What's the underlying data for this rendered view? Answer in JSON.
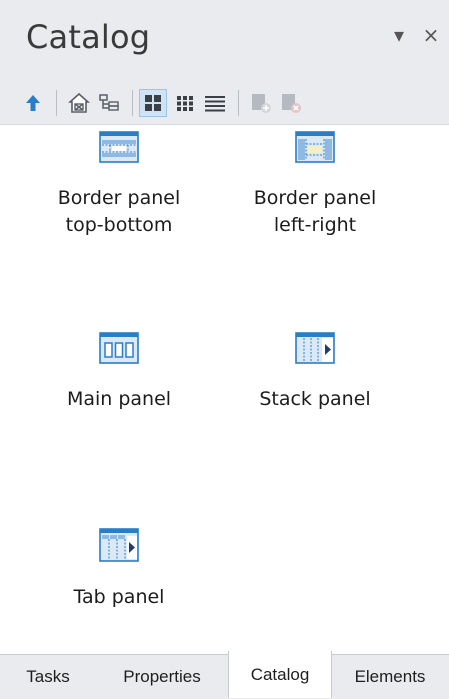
{
  "panel": {
    "title": "Catalog",
    "dropdown_icon": "triangle-down-icon",
    "close_icon": "close-icon",
    "dropdown_glyph": "▾",
    "close_glyph": "×"
  },
  "toolbar": {
    "buttons": [
      {
        "icon": "up-arrow-icon",
        "active": false
      },
      {
        "icon": "home-icon",
        "active": false
      },
      {
        "icon": "tree-view-icon",
        "active": false
      },
      {
        "icon": "large-icons-view-icon",
        "active": true
      },
      {
        "icon": "small-icons-view-icon",
        "active": false
      },
      {
        "icon": "list-view-icon",
        "active": false
      },
      {
        "icon": "add-item-icon",
        "active": false
      },
      {
        "icon": "remove-item-icon",
        "active": false
      }
    ]
  },
  "catalog": {
    "items": [
      {
        "label": "Border panel\ntop-bottom",
        "icon": "border-panel-top-bottom-icon"
      },
      {
        "label": "Border panel\nleft-right",
        "icon": "border-panel-left-right-icon"
      },
      {
        "label": "Main panel",
        "icon": "main-panel-icon"
      },
      {
        "label": "Stack panel",
        "icon": "stack-panel-icon"
      },
      {
        "label": "Tab panel",
        "icon": "tab-panel-icon"
      }
    ]
  },
  "tabs": [
    {
      "label": "Tasks",
      "active": false
    },
    {
      "label": "Properties",
      "active": false
    },
    {
      "label": "Catalog",
      "active": true
    },
    {
      "label": "Elements",
      "active": false
    }
  ],
  "colors": {
    "chrome_bg": "#e9ebee",
    "accent_blue": "#2a7ec7",
    "icon_fill": "#dbe9f6"
  }
}
